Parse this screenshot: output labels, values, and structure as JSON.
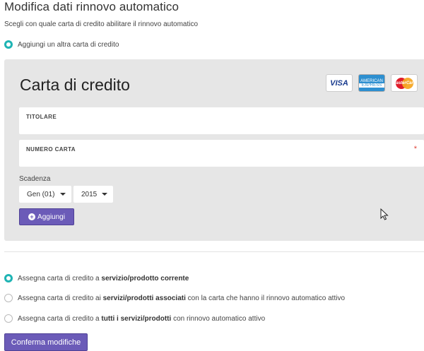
{
  "page": {
    "title": "Modifica dati rinnovo automatico",
    "subtitle": "Scegli con quale carta di credito abilitare il rinnovo automatico"
  },
  "add_card_option": {
    "label": "Aggiungi un altra carta di credito",
    "selected": true
  },
  "card_form": {
    "title": "Carta di credito",
    "logos": [
      {
        "name": "visa",
        "text": "VISA"
      },
      {
        "name": "american-express",
        "text_top": "AMERICAN",
        "text_bottom": "EXPRESS"
      },
      {
        "name": "mastercard",
        "text": "MasterCard"
      }
    ],
    "holder_label": "TITOLARE",
    "holder_value": "",
    "number_label": "NUMERO CARTA",
    "number_value": "",
    "required_mark": "*",
    "expiry_label": "Scadenza",
    "month_selected": "Gen (01)",
    "year_selected": "2015",
    "add_button": "Aggiungi"
  },
  "assign_options": [
    {
      "prefix": "Assegna carta di credito a ",
      "bold": "servizio/prodotto corrente",
      "suffix": "",
      "selected": true
    },
    {
      "prefix": "Assegna carta di credito ai ",
      "bold": "servizi/prodotti associati",
      "suffix": " con la carta che hanno il rinnovo automatico attivo",
      "selected": false
    },
    {
      "prefix": "Assegna carta di credito a ",
      "bold": "tutti i servizi/prodotti",
      "suffix": " con rinnovo automatico attivo",
      "selected": false
    }
  ],
  "confirm_button": "Conferma modifiche",
  "colors": {
    "accent": "#6b5bb8",
    "radio_checked": "#1fb4b4",
    "panel_bg": "#e6e6e6",
    "required": "#e0443a"
  }
}
